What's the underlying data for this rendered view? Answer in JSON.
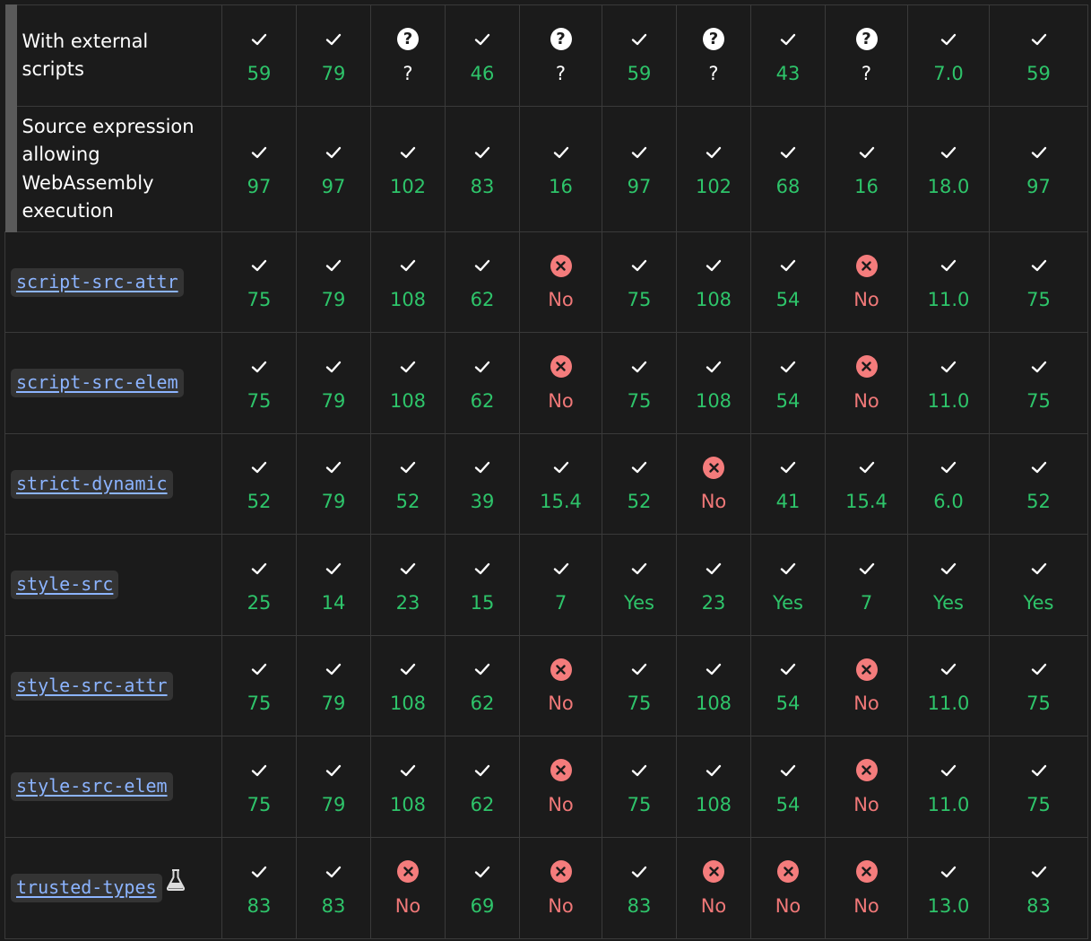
{
  "colors": {
    "background": "#1b1b1b",
    "supported": "#2ec46a",
    "unsupported": "#f07878",
    "unsupported_icon": "#f47c7c",
    "link": "#8cb4ff"
  },
  "rows": [
    {
      "name": "With external scripts",
      "kind": "text",
      "subfeature": true,
      "cells": [
        {
          "s": "yes",
          "v": "59"
        },
        {
          "s": "yes",
          "v": "79"
        },
        {
          "s": "unknown",
          "v": "?"
        },
        {
          "s": "yes",
          "v": "46"
        },
        {
          "s": "unknown",
          "v": "?"
        },
        {
          "s": "yes",
          "v": "59"
        },
        {
          "s": "unknown",
          "v": "?"
        },
        {
          "s": "yes",
          "v": "43"
        },
        {
          "s": "unknown",
          "v": "?"
        },
        {
          "s": "yes",
          "v": "7.0"
        },
        {
          "s": "yes",
          "v": "59"
        }
      ]
    },
    {
      "name": "Source expression allowing WebAssembly execution",
      "kind": "text",
      "subfeature": true,
      "cells": [
        {
          "s": "yes",
          "v": "97"
        },
        {
          "s": "yes",
          "v": "97"
        },
        {
          "s": "yes",
          "v": "102"
        },
        {
          "s": "yes",
          "v": "83"
        },
        {
          "s": "yes",
          "v": "16"
        },
        {
          "s": "yes",
          "v": "97"
        },
        {
          "s": "yes",
          "v": "102"
        },
        {
          "s": "yes",
          "v": "68"
        },
        {
          "s": "yes",
          "v": "16"
        },
        {
          "s": "yes",
          "v": "18.0"
        },
        {
          "s": "yes",
          "v": "97"
        }
      ]
    },
    {
      "name": "script-src-attr",
      "kind": "code",
      "cells": [
        {
          "s": "yes",
          "v": "75"
        },
        {
          "s": "yes",
          "v": "79"
        },
        {
          "s": "yes",
          "v": "108"
        },
        {
          "s": "yes",
          "v": "62"
        },
        {
          "s": "no",
          "v": "No"
        },
        {
          "s": "yes",
          "v": "75"
        },
        {
          "s": "yes",
          "v": "108"
        },
        {
          "s": "yes",
          "v": "54"
        },
        {
          "s": "no",
          "v": "No"
        },
        {
          "s": "yes",
          "v": "11.0"
        },
        {
          "s": "yes",
          "v": "75"
        }
      ]
    },
    {
      "name": "script-src-elem",
      "kind": "code",
      "cells": [
        {
          "s": "yes",
          "v": "75"
        },
        {
          "s": "yes",
          "v": "79"
        },
        {
          "s": "yes",
          "v": "108"
        },
        {
          "s": "yes",
          "v": "62"
        },
        {
          "s": "no",
          "v": "No"
        },
        {
          "s": "yes",
          "v": "75"
        },
        {
          "s": "yes",
          "v": "108"
        },
        {
          "s": "yes",
          "v": "54"
        },
        {
          "s": "no",
          "v": "No"
        },
        {
          "s": "yes",
          "v": "11.0"
        },
        {
          "s": "yes",
          "v": "75"
        }
      ]
    },
    {
      "name": "strict-dynamic",
      "kind": "code",
      "cells": [
        {
          "s": "yes",
          "v": "52"
        },
        {
          "s": "yes",
          "v": "79"
        },
        {
          "s": "yes",
          "v": "52"
        },
        {
          "s": "yes",
          "v": "39"
        },
        {
          "s": "yes",
          "v": "15.4"
        },
        {
          "s": "yes",
          "v": "52"
        },
        {
          "s": "no",
          "v": "No"
        },
        {
          "s": "yes",
          "v": "41"
        },
        {
          "s": "yes",
          "v": "15.4"
        },
        {
          "s": "yes",
          "v": "6.0"
        },
        {
          "s": "yes",
          "v": "52"
        }
      ]
    },
    {
      "name": "style-src",
      "kind": "code",
      "cells": [
        {
          "s": "yes",
          "v": "25"
        },
        {
          "s": "yes",
          "v": "14"
        },
        {
          "s": "yes",
          "v": "23"
        },
        {
          "s": "yes",
          "v": "15"
        },
        {
          "s": "yes",
          "v": "7"
        },
        {
          "s": "yes",
          "v": "Yes"
        },
        {
          "s": "yes",
          "v": "23"
        },
        {
          "s": "yes",
          "v": "Yes"
        },
        {
          "s": "yes",
          "v": "7"
        },
        {
          "s": "yes",
          "v": "Yes"
        },
        {
          "s": "yes",
          "v": "Yes"
        }
      ]
    },
    {
      "name": "style-src-attr",
      "kind": "code",
      "cells": [
        {
          "s": "yes",
          "v": "75"
        },
        {
          "s": "yes",
          "v": "79"
        },
        {
          "s": "yes",
          "v": "108"
        },
        {
          "s": "yes",
          "v": "62"
        },
        {
          "s": "no",
          "v": "No"
        },
        {
          "s": "yes",
          "v": "75"
        },
        {
          "s": "yes",
          "v": "108"
        },
        {
          "s": "yes",
          "v": "54"
        },
        {
          "s": "no",
          "v": "No"
        },
        {
          "s": "yes",
          "v": "11.0"
        },
        {
          "s": "yes",
          "v": "75"
        }
      ]
    },
    {
      "name": "style-src-elem",
      "kind": "code",
      "cells": [
        {
          "s": "yes",
          "v": "75"
        },
        {
          "s": "yes",
          "v": "79"
        },
        {
          "s": "yes",
          "v": "108"
        },
        {
          "s": "yes",
          "v": "62"
        },
        {
          "s": "no",
          "v": "No"
        },
        {
          "s": "yes",
          "v": "75"
        },
        {
          "s": "yes",
          "v": "108"
        },
        {
          "s": "yes",
          "v": "54"
        },
        {
          "s": "no",
          "v": "No"
        },
        {
          "s": "yes",
          "v": "11.0"
        },
        {
          "s": "yes",
          "v": "75"
        }
      ]
    },
    {
      "name": "trusted-types",
      "kind": "code",
      "experimental": true,
      "cells": [
        {
          "s": "yes",
          "v": "83"
        },
        {
          "s": "yes",
          "v": "83"
        },
        {
          "s": "no",
          "v": "No"
        },
        {
          "s": "yes",
          "v": "69"
        },
        {
          "s": "no",
          "v": "No"
        },
        {
          "s": "yes",
          "v": "83"
        },
        {
          "s": "no",
          "v": "No"
        },
        {
          "s": "no",
          "v": "No"
        },
        {
          "s": "no",
          "v": "No"
        },
        {
          "s": "yes",
          "v": "13.0"
        },
        {
          "s": "yes",
          "v": "83"
        }
      ]
    }
  ]
}
